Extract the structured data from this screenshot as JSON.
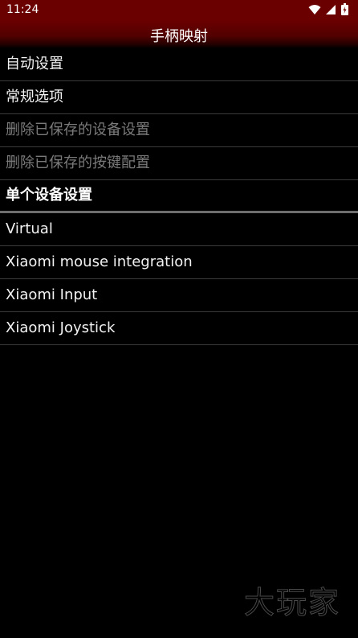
{
  "status_bar": {
    "time": "11:24",
    "icons": [
      "wifi-icon",
      "signal-icon",
      "battery-icon"
    ]
  },
  "title_bar": {
    "title": "手柄映射"
  },
  "menu": {
    "items": [
      {
        "label": "自动设置",
        "enabled": true
      },
      {
        "label": "常规选项",
        "enabled": true
      },
      {
        "label": "删除已保存的设备设置",
        "enabled": false
      },
      {
        "label": "删除已保存的按键配置",
        "enabled": false
      }
    ],
    "section_header": "单个设备设置",
    "devices": [
      {
        "label": "Virtual"
      },
      {
        "label": "Xiaomi mouse integration"
      },
      {
        "label": "Xiaomi Input"
      },
      {
        "label": "Xiaomi Joystick"
      }
    ]
  },
  "watermark": {
    "text": "大玩家"
  },
  "colors": {
    "title_bar": "#6a0000",
    "background": "#000000",
    "text": "#ffffff",
    "disabled_text": "#7a7a7a",
    "divider": "#3a3a3a"
  }
}
